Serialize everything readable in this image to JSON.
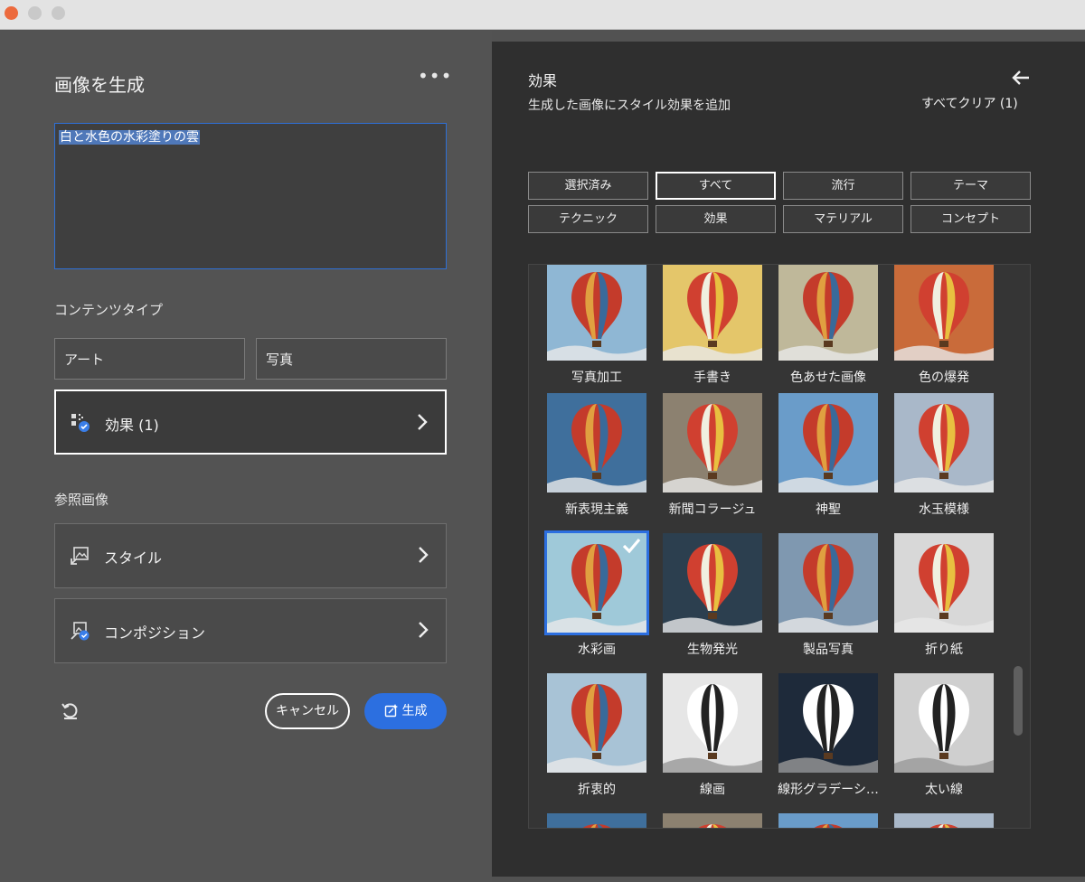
{
  "window": {
    "controls": [
      "close",
      "minimize",
      "maximize"
    ]
  },
  "left_panel": {
    "title": "画像を生成",
    "more_label": "•••",
    "prompt_text": "白と水色の水彩塗りの雲",
    "content_type": {
      "label": "コンテンツタイプ",
      "art_label": "アート",
      "photo_label": "写真"
    },
    "effects_button": {
      "label": "効果 (1)"
    },
    "reference": {
      "label": "参照画像",
      "style_label": "スタイル",
      "composition_label": "コンポジション"
    },
    "cancel_label": "キャンセル",
    "generate_label": "生成"
  },
  "right_panel": {
    "title": "効果",
    "subtitle": "生成した画像にスタイル効果を追加",
    "clear_label": "すべてクリア (1)",
    "filters": [
      "選択済み",
      "すべて",
      "流行",
      "テーマ",
      "テクニック",
      "効果",
      "マテリアル",
      "コンセプト"
    ],
    "selected_filter": "すべて",
    "thumbnails": [
      [
        "写真加工",
        "手書き",
        "色あせた画像",
        "色の爆発"
      ],
      [
        "新表現主義",
        "新聞コラージュ",
        "神聖",
        "水玉模様"
      ],
      [
        "水彩画",
        "生物発光",
        "製品写真",
        "折り紙"
      ],
      [
        "折衷的",
        "線画",
        "線形グラデーシ…",
        "太い線"
      ]
    ],
    "selected_thumbnail": "水彩画"
  },
  "colors": {
    "accent": "#2c6fe0",
    "left_bg": "#535353",
    "right_bg": "#2f2f2f"
  }
}
